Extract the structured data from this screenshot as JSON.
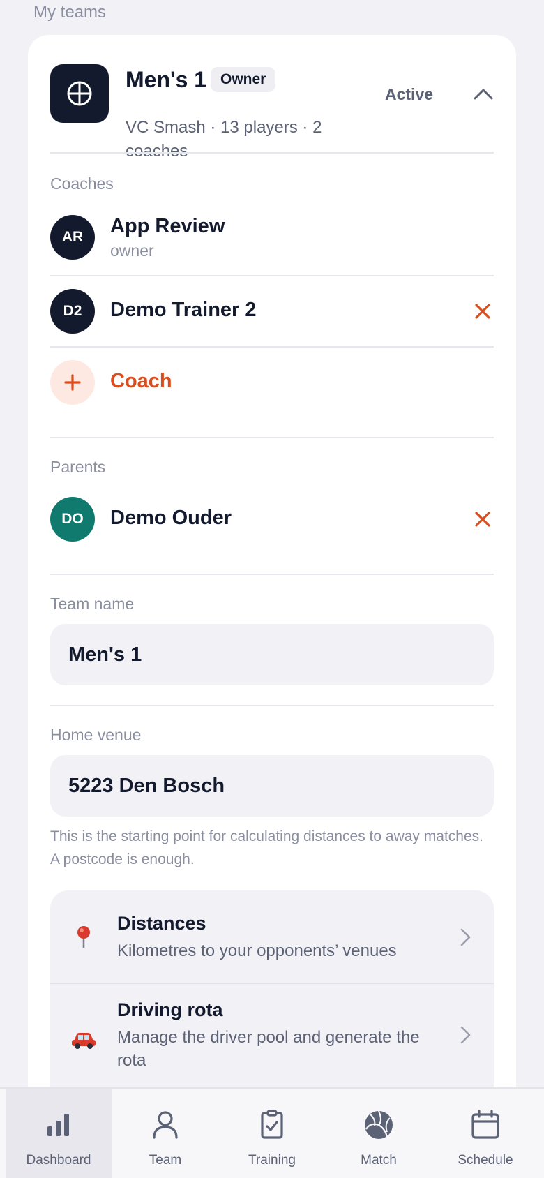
{
  "page": {
    "section_title": "My teams"
  },
  "team": {
    "name": "Men's 1",
    "badge": "Owner",
    "subtitle": "VC Smash · 13 players · 2 coaches",
    "status": "Active",
    "logo_icon": "volleyball-icon"
  },
  "coaches": {
    "label": "Coaches",
    "items": [
      {
        "initials": "AR",
        "name": "App Review",
        "role": "owner"
      },
      {
        "initials": "D2",
        "name": "Demo Trainer 2"
      }
    ],
    "add_label": "Coach"
  },
  "parents": {
    "label": "Parents",
    "items": [
      {
        "initials": "DO",
        "name": "Demo Ouder"
      }
    ]
  },
  "team_name_field": {
    "label": "Team name",
    "value": "Men's 1"
  },
  "home_venue_field": {
    "label": "Home venue",
    "value": "5223 Den Bosch",
    "help": "This is the starting point for calculating distances to away matches. A postcode is enough."
  },
  "menu": [
    {
      "icon": "pin-icon",
      "title": "Distances",
      "description": "Kilometres to your opponents’ venues"
    },
    {
      "icon": "car-icon",
      "title": "Driving rota",
      "description": "Manage the driver pool and generate the rota"
    }
  ],
  "tabs": [
    {
      "label": "Dashboard",
      "icon": "chart-icon",
      "active": true
    },
    {
      "label": "Team",
      "icon": "person-icon"
    },
    {
      "label": "Training",
      "icon": "clipboard-check-icon"
    },
    {
      "label": "Match",
      "icon": "volleyball-icon"
    },
    {
      "label": "Schedule",
      "icon": "calendar-icon"
    }
  ],
  "colors": {
    "accent": "#d94d1e",
    "dark": "#141a2e",
    "teal": "#0f7a6d",
    "background": "#f1f1f6"
  }
}
